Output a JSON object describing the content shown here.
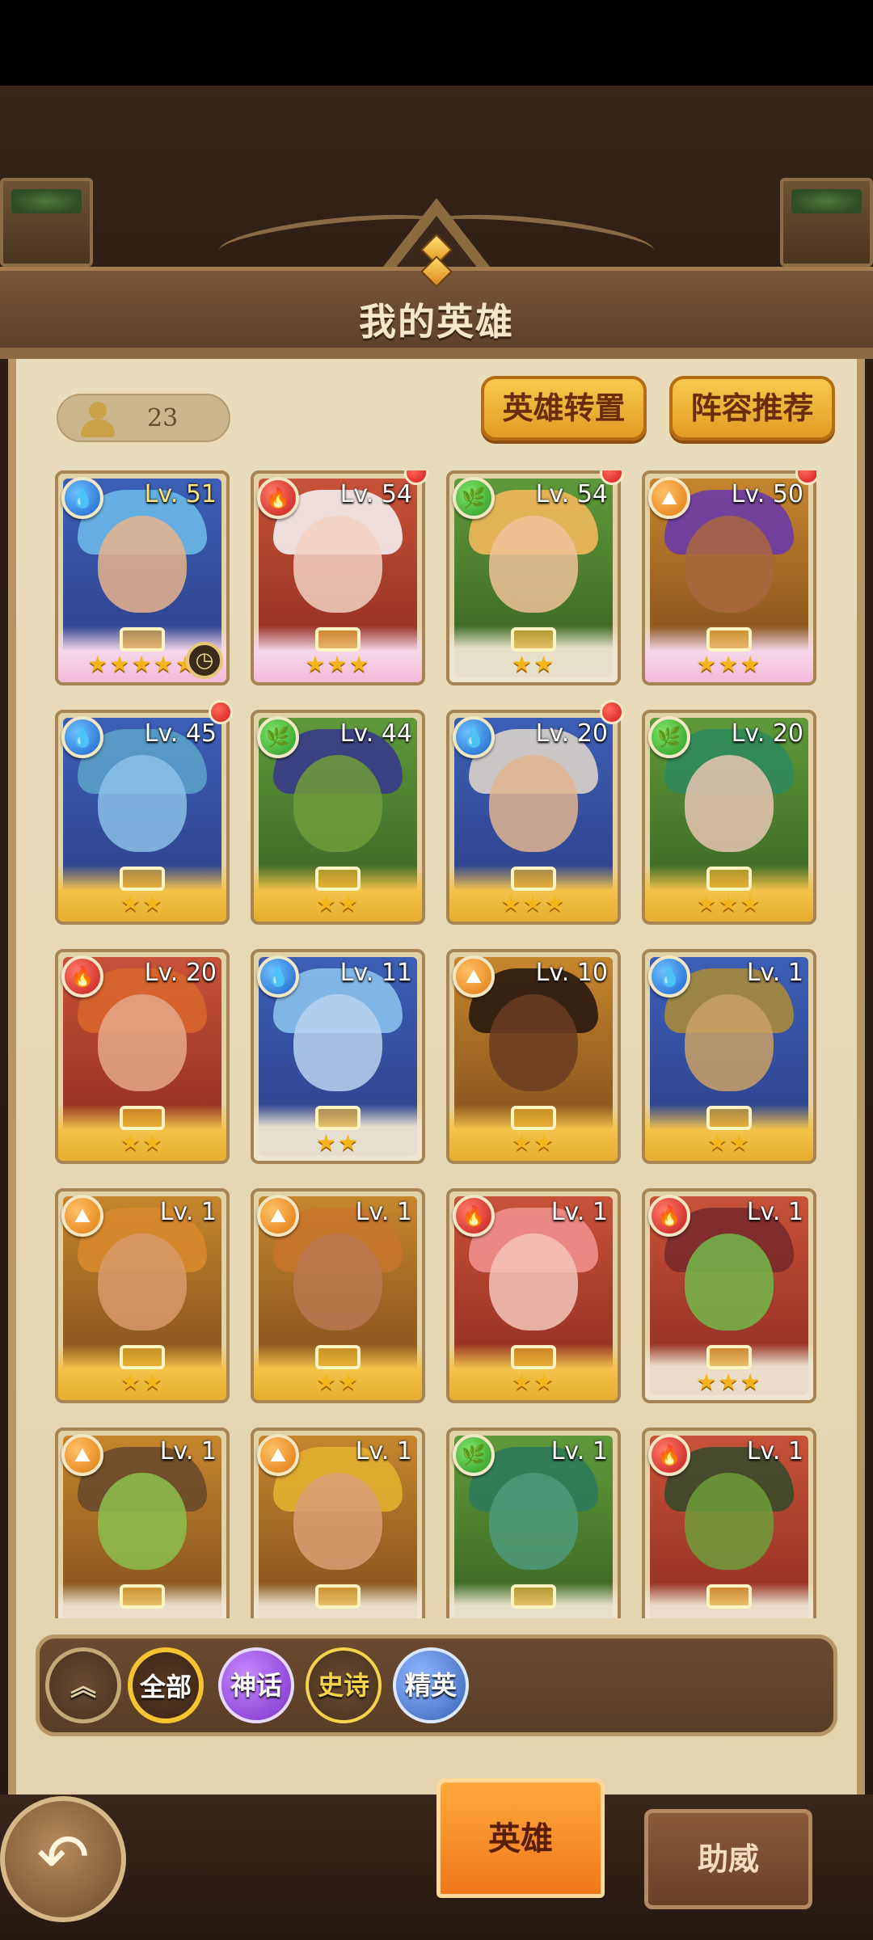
{
  "header": {
    "title": "我的英雄"
  },
  "hero_count": "23",
  "buttons": {
    "transfer": "英雄转置",
    "recommend": "阵容推荐"
  },
  "heroes": [
    {
      "element": "water",
      "level": "Lv. 51",
      "stars": "★★★★★",
      "frame": "crown",
      "new": false,
      "timer": true
    },
    {
      "element": "fire",
      "level": "Lv. 54",
      "stars": "★★★",
      "frame": "crown",
      "new": true,
      "timer": false
    },
    {
      "element": "nature",
      "level": "Lv. 54",
      "stars": "★★",
      "frame": "silver",
      "new": true,
      "timer": false
    },
    {
      "element": "earth",
      "level": "Lv. 50",
      "stars": "★★★",
      "frame": "crown",
      "new": true,
      "timer": false
    },
    {
      "element": "water",
      "level": "Lv. 45",
      "stars": "★★",
      "frame": "gold",
      "new": true,
      "timer": false
    },
    {
      "element": "nature",
      "level": "Lv. 44",
      "stars": "★★",
      "frame": "gold",
      "new": false,
      "timer": false
    },
    {
      "element": "water",
      "level": "Lv. 20",
      "stars": "★★★",
      "frame": "gold",
      "new": true,
      "timer": false
    },
    {
      "element": "nature",
      "level": "Lv. 20",
      "stars": "★★★",
      "frame": "gold",
      "new": false,
      "timer": false
    },
    {
      "element": "fire",
      "level": "Lv. 20",
      "stars": "★★",
      "frame": "gold",
      "new": false,
      "timer": false
    },
    {
      "element": "water",
      "level": "Lv. 11",
      "stars": "★★",
      "frame": "silver",
      "new": false,
      "timer": false
    },
    {
      "element": "earth",
      "level": "Lv. 10",
      "stars": "★★",
      "frame": "gold",
      "new": false,
      "timer": false
    },
    {
      "element": "water",
      "level": "Lv. 1",
      "stars": "★★",
      "frame": "gold",
      "new": false,
      "timer": false
    },
    {
      "element": "earth",
      "level": "Lv. 1",
      "stars": "★★",
      "frame": "gold",
      "new": false,
      "timer": false
    },
    {
      "element": "earth",
      "level": "Lv. 1",
      "stars": "★★",
      "frame": "gold",
      "new": false,
      "timer": false
    },
    {
      "element": "fire",
      "level": "Lv. 1",
      "stars": "★★",
      "frame": "gold",
      "new": false,
      "timer": false
    },
    {
      "element": "fire",
      "level": "Lv. 1",
      "stars": "★★★",
      "frame": "silver",
      "new": false,
      "timer": false
    },
    {
      "element": "earth",
      "level": "Lv. 1",
      "stars": "",
      "frame": "silver",
      "new": false,
      "timer": false
    },
    {
      "element": "earth",
      "level": "Lv. 1",
      "stars": "",
      "frame": "silver",
      "new": false,
      "timer": false
    },
    {
      "element": "nature",
      "level": "Lv. 1",
      "stars": "",
      "frame": "silver",
      "new": false,
      "timer": false
    },
    {
      "element": "fire",
      "level": "Lv. 1",
      "stars": "",
      "frame": "silver",
      "new": false,
      "timer": false
    }
  ],
  "filters": {
    "all": "全部",
    "myth": "神话",
    "epic": "史诗",
    "elite": "精英"
  },
  "tabs": {
    "hero": "英雄",
    "assist": "助威"
  },
  "colors": {
    "water": "#1a62c9",
    "fire": "#c41c1c",
    "nature": "#2a9a22",
    "earth": "#e2790e",
    "accent_gold": "#f5c531",
    "tab_active": "#f0781a"
  }
}
